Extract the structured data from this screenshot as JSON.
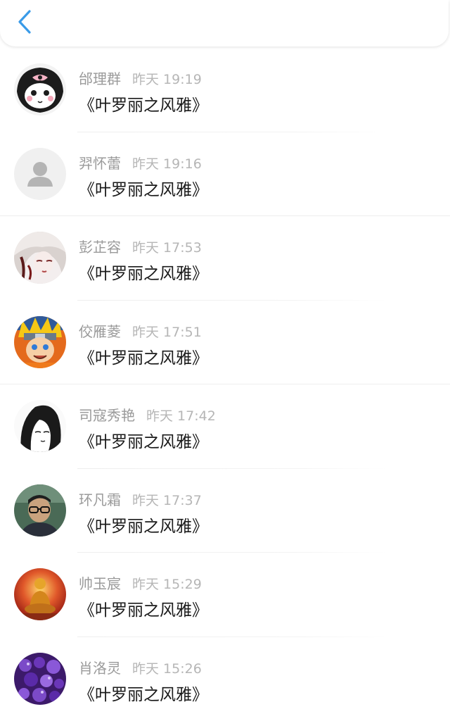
{
  "header": {
    "back_icon": "chevron-left-icon",
    "accent_color": "#3a9be8"
  },
  "items": [
    {
      "name": "邰理群",
      "time": "昨天 19:19",
      "message": "《叶罗丽之风雅》",
      "avatar": "kuromi-avatar"
    },
    {
      "name": "羿怀蕾",
      "time": "昨天 19:16",
      "message": "《叶罗丽之风雅》",
      "avatar": "default-user-avatar"
    },
    {
      "name": "彭芷容",
      "time": "昨天 17:53",
      "message": "《叶罗丽之风雅》",
      "avatar": "anime-girl-avatar"
    },
    {
      "name": "佼雁菱",
      "time": "昨天 17:51",
      "message": "《叶罗丽之风雅》",
      "avatar": "naruto-avatar"
    },
    {
      "name": "司寇秀艳",
      "time": "昨天 17:42",
      "message": "《叶罗丽之风雅》",
      "avatar": "sketch-girl-avatar"
    },
    {
      "name": "环凡霜",
      "time": "昨天 17:37",
      "message": "《叶罗丽之风雅》",
      "avatar": "glasses-man-avatar"
    },
    {
      "name": "帅玉宸",
      "time": "昨天 15:29",
      "message": "《叶罗丽之风雅》",
      "avatar": "buddha-avatar"
    },
    {
      "name": "肖洛灵",
      "time": "昨天 15:26",
      "message": "《叶罗丽之风雅》",
      "avatar": "purple-beads-avatar"
    }
  ]
}
